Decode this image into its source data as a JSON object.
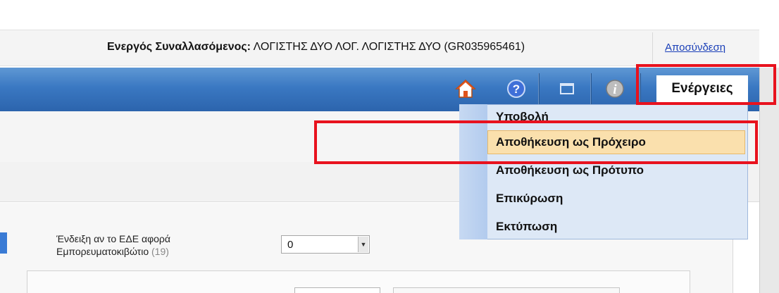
{
  "header": {
    "active_user_label": "Ενεργός Συναλλασόμενος:",
    "active_user_value": "ΛΟΓΙΣΤΗΣ ΔΥΟ ΛΟΓ. ΛΟΓΙΣΤΗΣ ΔΥΟ (GR035965461)",
    "logout_label": "Αποσύνδεση"
  },
  "toolbar": {
    "icons": [
      "home-icon",
      "help-icon",
      "window-icon",
      "info-icon"
    ],
    "actions_label": "Ενέργειες"
  },
  "actions_menu": {
    "items": [
      {
        "label": "Υποβολή"
      },
      {
        "label": "Αποθήκευση ως Πρόχειρο",
        "highlighted": true
      },
      {
        "label": "Αποθήκευση ως Πρότυπο"
      },
      {
        "label": "Επικύρωση"
      },
      {
        "label": "Εκτύπωση"
      }
    ]
  },
  "form": {
    "container_field": {
      "label_line1": "Ένδειξη αν το ΕΔΕ αφορά",
      "label_line2": "Εμπορευματοκιβώτιο",
      "label_suffix": "(19)",
      "value": "0"
    }
  },
  "colors": {
    "toolbar_blue": "#3a78c2",
    "highlight_red": "#e8121e",
    "menu_bg": "#dde8f6",
    "menu_highlight": "#fae0ad",
    "link_blue": "#1a3fb8"
  }
}
